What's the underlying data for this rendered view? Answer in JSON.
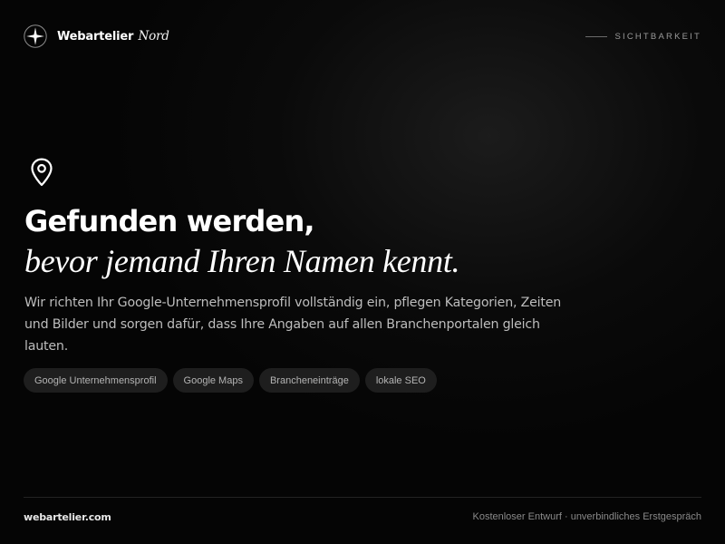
{
  "header": {
    "logo_icon": "compass-star-icon",
    "brand_name": "Webartelier",
    "brand_accent": "Nord",
    "section_label": "SICHTBARKEIT"
  },
  "hero": {
    "icon": "map-pin-icon",
    "headline": "Gefunden werden,",
    "subheadline": "bevor jemand Ihren Namen kennt.",
    "description": "Wir richten Ihr Google-Unternehmensprofil vollständig ein, pflegen Kategorien, Zeiten und Bilder und sorgen dafür, dass Ihre Angaben auf allen Branchenportalen gleich lauten.",
    "tags": [
      "Google Unternehmensprofil",
      "Google Maps",
      "Brancheneinträge",
      "lokale SEO"
    ]
  },
  "footer": {
    "url": "webartelier.com",
    "note": "Kostenloser Entwurf · unverbindliches Erstgespräch"
  },
  "colors": {
    "background": "#050505",
    "text_primary": "#ffffff",
    "text_secondary": "#bdbdbd",
    "tag_background": "#1e1e1e",
    "muted": "#8a8a8a"
  }
}
